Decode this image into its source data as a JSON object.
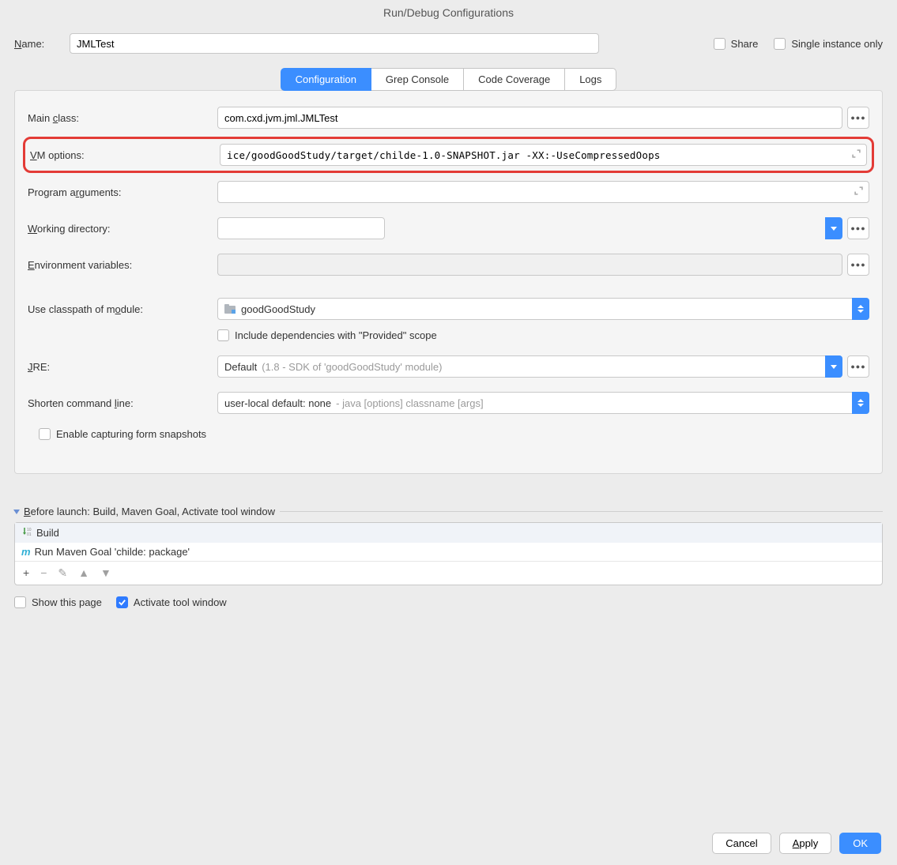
{
  "dialog_title": "Run/Debug Configurations",
  "name_label": "Name:",
  "name_value": "JMLTest",
  "share_label": "Share",
  "single_instance_label": "Single instance only",
  "tabs": {
    "configuration": "Configuration",
    "grep_console": "Grep Console",
    "code_coverage": "Code Coverage",
    "logs": "Logs"
  },
  "form": {
    "main_class_label": "Main class:",
    "main_class_value": "com.cxd.jvm.jml.JMLTest",
    "vm_options_label": "VM options:",
    "vm_options_value": "ice/goodGoodStudy/target/childe-1.0-SNAPSHOT.jar -XX:-UseCompressedOops",
    "program_args_label": "Program arguments:",
    "program_args_value": "",
    "working_dir_label": "Working directory:",
    "working_dir_value": "",
    "env_vars_label": "Environment variables:",
    "env_vars_value": "",
    "classpath_label": "Use classpath of module:",
    "classpath_value": "goodGoodStudy",
    "include_deps_label": "Include dependencies with \"Provided\" scope",
    "jre_label": "JRE:",
    "jre_value": "Default",
    "jre_hint": "(1.8 - SDK of 'goodGoodStudy' module)",
    "shorten_label": "Shorten command line:",
    "shorten_value": "user-local default: none",
    "shorten_hint": "- java [options] classname [args]",
    "enable_snapshots_label": "Enable capturing form snapshots"
  },
  "before_launch": {
    "header": "Before launch: Build, Maven Goal, Activate tool window",
    "items": {
      "build": "Build",
      "maven": "Run Maven Goal 'childe: package'"
    }
  },
  "show_this_page": "Show this page",
  "activate_tool_window": "Activate tool window",
  "buttons": {
    "cancel": "Cancel",
    "apply": "Apply",
    "ok": "OK"
  }
}
